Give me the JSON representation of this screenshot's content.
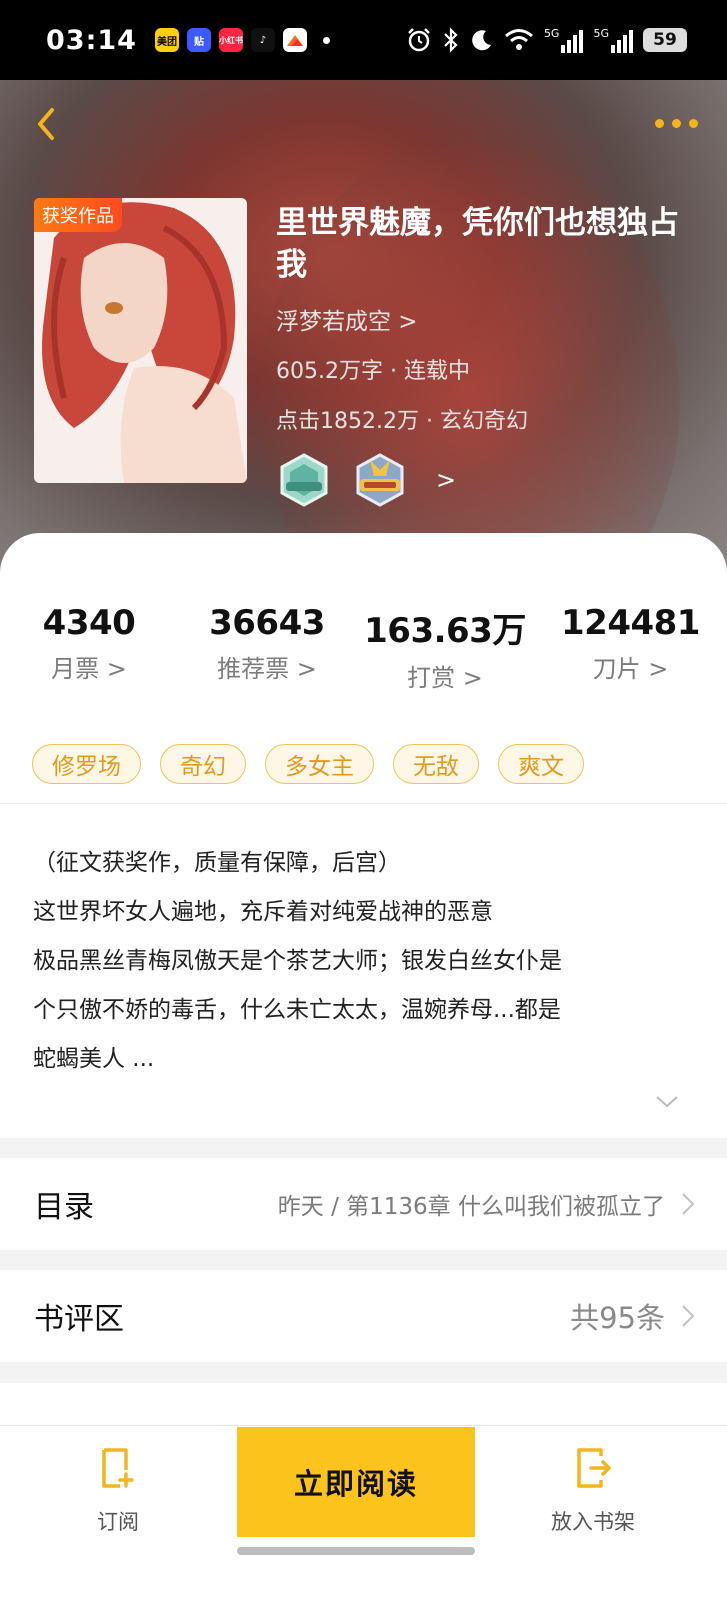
{
  "status_bar": {
    "time": "03:14",
    "apps": [
      {
        "name": "美团",
        "color": "#ffd100"
      },
      {
        "name": "贴",
        "color": "#3b5bff"
      },
      {
        "name": "小红书",
        "color": "#ff2442"
      },
      {
        "name": "♪",
        "color": "#111111"
      },
      {
        "name": "",
        "color": "#ff6a2b"
      }
    ],
    "network_1": "5G",
    "network_2": "5G",
    "battery": "59"
  },
  "book": {
    "award_badge": "获奖作品",
    "title": "里世界魅魔，凭你们也想独占我",
    "author": "浮梦若成空 >",
    "meta_words_status": "605.2万字 · 连载中",
    "meta_clicks_genre": "点击1852.2万 · 玄幻奇幻",
    "medals_more": ">"
  },
  "stats": [
    {
      "value": "4340",
      "label": "月票 >"
    },
    {
      "value": "36643",
      "label": "推荐票 >"
    },
    {
      "value": "163.63万",
      "label": "打赏 >"
    },
    {
      "value": "124481",
      "label": "刀片 >"
    }
  ],
  "tags": [
    "修罗场",
    "奇幻",
    "多女主",
    "无敌",
    "爽文"
  ],
  "synopsis": {
    "line1": "（征文获奖作，质量有保障，后宫）",
    "line2": "这世界坏女人遍地，充斥着对纯爱战神的恶意",
    "line3": "极品黑丝青梅凤傲天是个茶艺大师；银发白丝女仆是",
    "line4": "个只傲不娇的毒舌，什么未亡太太，温婉养母...都是",
    "line5": "蛇蝎美人 ..."
  },
  "toc": {
    "title": "目录",
    "latest": "昨天 / 第1136章 什么叫我们被孤立了"
  },
  "reviews": {
    "title": "书评区",
    "count": "共95条"
  },
  "bottom": {
    "subscribe": "订阅",
    "read_now": "立即阅读",
    "add_shelf": "放入书架"
  },
  "colors": {
    "accent": "#fbc31b",
    "tag_text": "#e39a1e",
    "back_arrow": "#f3b51b"
  }
}
